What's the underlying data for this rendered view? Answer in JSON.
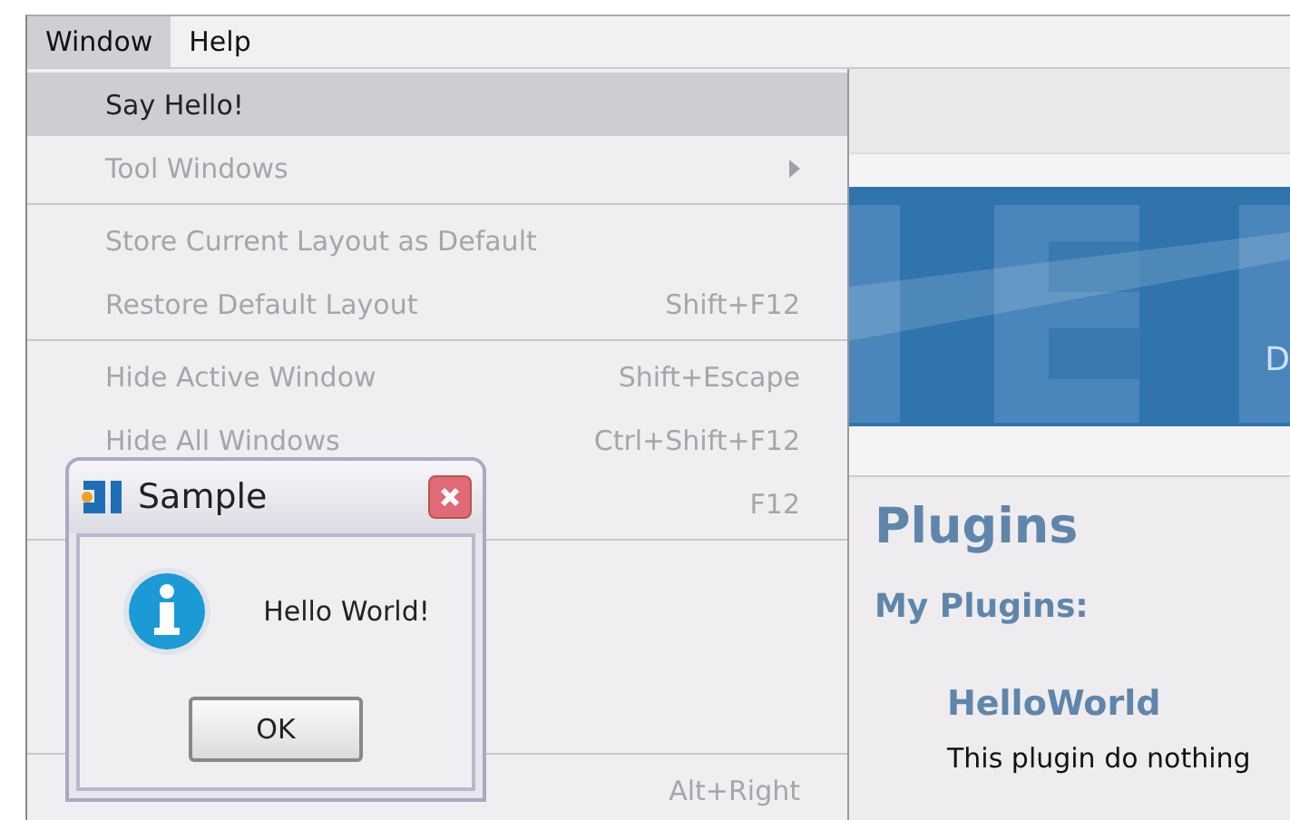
{
  "menubar": [
    {
      "label": "Window",
      "selected": true
    },
    {
      "label": "Help",
      "selected": false
    }
  ],
  "menu": {
    "items": [
      {
        "kind": "item",
        "label": "Say Hello!",
        "disabled": false,
        "selected": true
      },
      {
        "kind": "submenu",
        "label": "Tool Windows",
        "disabled": true,
        "selected": false
      },
      {
        "kind": "separator"
      },
      {
        "kind": "item",
        "label": "Store Current Layout as Default",
        "disabled": true,
        "selected": false
      },
      {
        "kind": "item",
        "label": "Restore Default Layout",
        "shortcut": "Shift+F12",
        "disabled": true,
        "selected": false
      },
      {
        "kind": "separator"
      },
      {
        "kind": "item",
        "label": "Hide Active Window",
        "shortcut": "Shift+Escape",
        "disabled": true,
        "selected": false
      },
      {
        "kind": "item",
        "label": "Hide All Windows",
        "shortcut": "Ctrl+Shift+F12",
        "disabled": true,
        "selected": false
      },
      {
        "kind": "item",
        "shortcut": "F12",
        "disabled": true,
        "selected": false
      },
      {
        "kind": "separator"
      },
      {
        "kind": "separator"
      },
      {
        "kind": "item",
        "shortcut": "Alt+Right",
        "disabled": true,
        "selected": false
      }
    ]
  },
  "banner": {
    "text": "D"
  },
  "content": {
    "title": "Plugins",
    "subtitle": "My Plugins:",
    "plugins": [
      {
        "name": "HelloWorld",
        "description": "This plugin do nothing"
      }
    ]
  },
  "dialog": {
    "title": "Sample",
    "message": "Hello World!",
    "button": "OK"
  }
}
